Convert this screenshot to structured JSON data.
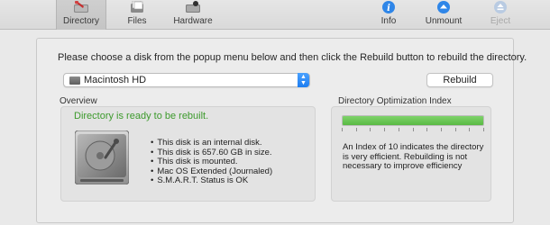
{
  "toolbar": {
    "items": [
      {
        "label": "Directory",
        "icon": "wrench-disk-icon",
        "active": true
      },
      {
        "label": "Files",
        "icon": "files-icon",
        "active": false
      },
      {
        "label": "Hardware",
        "icon": "hardware-icon",
        "active": false
      },
      {
        "label": "Info",
        "icon": "info-icon",
        "active": false
      },
      {
        "label": "Unmount",
        "icon": "unmount-icon",
        "active": false
      },
      {
        "label": "Eject",
        "icon": "eject-icon",
        "active": false,
        "disabled": true
      }
    ]
  },
  "main": {
    "instructions": "Please choose a disk from the popup menu below and then click the Rebuild button to rebuild the directory.",
    "disk_popup": {
      "selected": "Macintosh HD"
    },
    "rebuild_label": "Rebuild"
  },
  "overview": {
    "title": "Overview",
    "status": "Directory is ready to be rebuilt.",
    "facts": [
      "This disk is an internal disk.",
      "This disk is 657.60 GB in size.",
      "This disk is mounted.",
      "Mac OS Extended (Journaled)",
      "S.M.A.R.T. Status is OK"
    ]
  },
  "directory_index": {
    "title": "Directory Optimization Index",
    "level_fraction": 1.0,
    "tick_count": 11,
    "description": "An Index of 10 indicates the directory is very efficient. Rebuilding is not necessary to improve efficiency"
  },
  "colors": {
    "accent_blue": "#1d7df0",
    "status_green": "#3c9a2c",
    "gauge_green": "#59b943"
  }
}
